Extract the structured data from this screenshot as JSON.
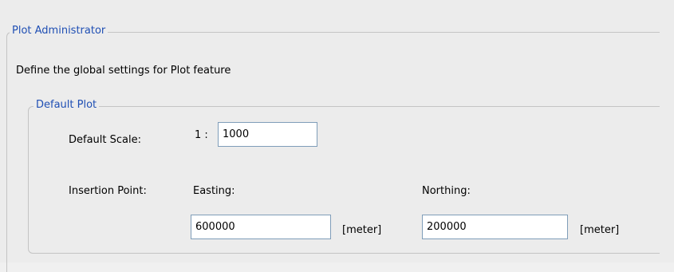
{
  "dialog": {
    "group_title": "Plot Administrator",
    "description": "Define the global settings for Plot feature"
  },
  "default_plot": {
    "group_title": "Default Plot",
    "scale_label": "Default Scale:",
    "scale_prefix": "1 :",
    "scale_value": "1000",
    "insertion_label": "Insertion Point:",
    "easting_label": "Easting:",
    "easting_value": "600000",
    "easting_unit": "[meter]",
    "northing_label": "Northing:",
    "northing_value": "200000",
    "northing_unit": "[meter]"
  }
}
